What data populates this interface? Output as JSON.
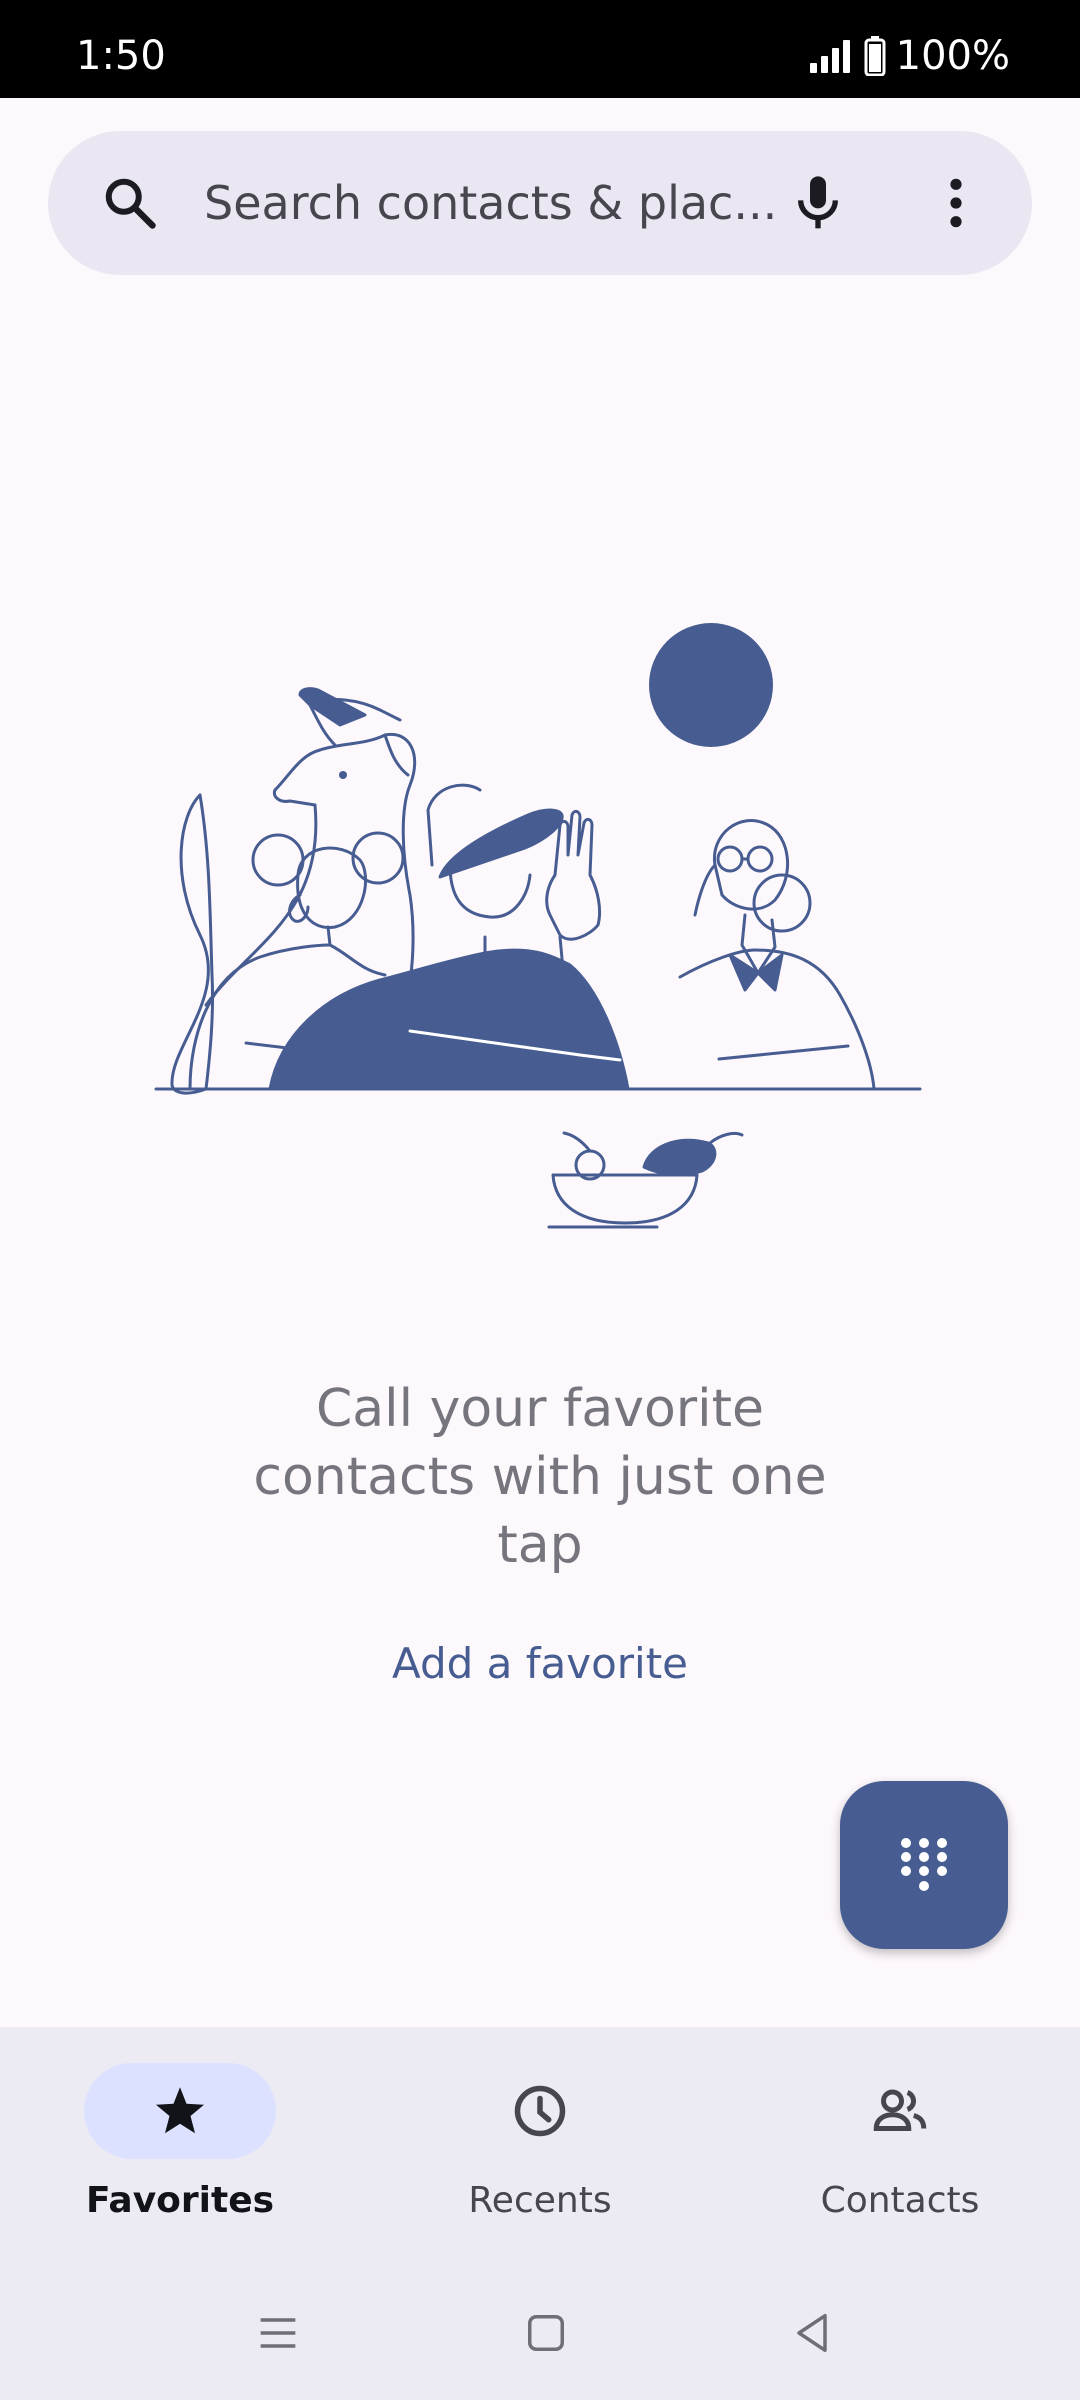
{
  "status_bar": {
    "time": "1:50",
    "battery": "100%"
  },
  "search": {
    "placeholder": "Search contacts & plac..."
  },
  "empty_state": {
    "message": "Call your favorite contacts with just one tap",
    "action_label": "Add a favorite"
  },
  "bottom_nav": {
    "items": [
      {
        "label": "Favorites",
        "icon": "star-icon",
        "active": true
      },
      {
        "label": "Recents",
        "icon": "clock-icon",
        "active": false
      },
      {
        "label": "Contacts",
        "icon": "people-icon",
        "active": false
      }
    ]
  },
  "colors": {
    "primary": "#475d92",
    "background": "#fdf8fc",
    "surface": "#eae7f2",
    "nav_background": "#ecebf4",
    "active_indicator": "#dbe1ff"
  }
}
